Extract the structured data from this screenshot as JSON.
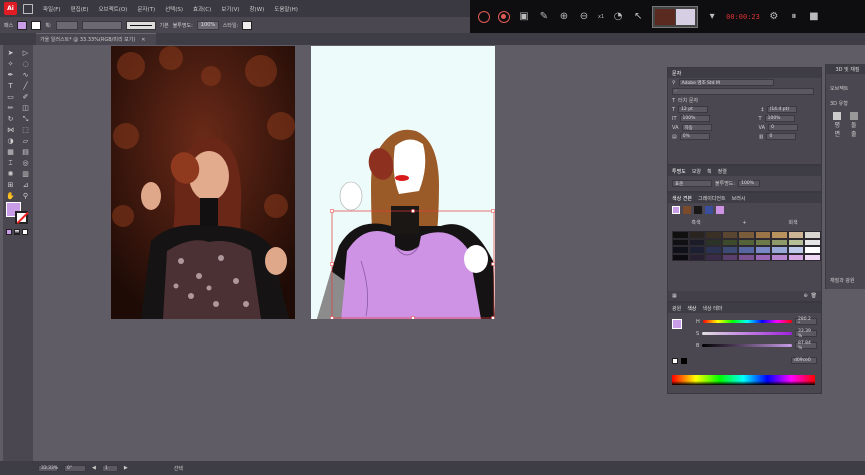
{
  "menubar": {
    "logo": "Ai",
    "items": [
      "파일(F)",
      "편집(E)",
      "오브젝트(O)",
      "문자(T)",
      "선택(S)",
      "효과(C)",
      "보기(V)",
      "창(W)",
      "도움말(H)"
    ]
  },
  "controlbar": {
    "selection_label": "패스",
    "stroke_label": "획:",
    "brush_label": "기본",
    "opacity_label": "불투명도:",
    "opacity_value": "100%",
    "style_label": "스타일:"
  },
  "doc_tab": {
    "title": "가을 일러스트* @ 33.33%(RGB/미리 보기)"
  },
  "colors": {
    "fill": "#c99ce8",
    "accent": "#e05a55"
  },
  "character_panel": {
    "tab_label": "문자",
    "font_family": "Adobe 명조 Std M",
    "font_style": "-",
    "touch_type_label": "터치 문자",
    "font_size": "12 pt",
    "leading": "(14.4 pt)",
    "vscale": "100%",
    "hscale": "100%",
    "kerning": "자동",
    "tracking": "0",
    "tsume": "0%",
    "aki": "0"
  },
  "appearance_panel": {
    "tabs": [
      "투명도",
      "모양",
      "획",
      "정렬"
    ],
    "blend_mode": "표준",
    "opacity_label": "불투명도:",
    "opacity_value": "100%"
  },
  "swatches_panel": {
    "tabs": [
      "색상 견본",
      "그레이디언트",
      "브러시"
    ],
    "group1_label": "흑색",
    "group2_label": "+",
    "group3_label": "회색",
    "swatch_colors": [
      "#101010",
      "#2a2420",
      "#3b3026",
      "#5a4530",
      "#7a5c3a",
      "#9b7448",
      "#b8935e",
      "#cdb495",
      "#d9d6d2",
      "#0f0f14",
      "#1c1c28",
      "#2b3326",
      "#3e4a2c",
      "#55633a",
      "#6d7a4a",
      "#8f9a6a",
      "#b6bf98",
      "#e6e6e6",
      "#101018",
      "#1d2033",
      "#2c3352",
      "#3d4a73",
      "#5566a0",
      "#7a88c8",
      "#9aa8d8",
      "#bfc9ea",
      "#ffffff",
      "#0c0c10",
      "#262030",
      "#3a2c48",
      "#5a3f6c",
      "#7b5292",
      "#9a66b6",
      "#b986d0",
      "#d5a8e4",
      "#efd8f4"
    ]
  },
  "color_panel": {
    "tabs": [
      "색상",
      "색상 테마"
    ],
    "h_label": "H",
    "h_value": "280.2 °",
    "s_label": "S",
    "s_value": "33.39 %",
    "b_label": "B",
    "b_value": "87.84 %",
    "hex_value": "d09ce0",
    "guide_tab": "광원"
  },
  "side_panel": {
    "tabs": [
      "3D 및 재질",
      "오브젝트"
    ],
    "sections": [
      "3D 유형",
      "평면",
      "돌출",
      "회전",
      "부풀리기"
    ],
    "footer": "재질과 광원"
  },
  "recorder": {
    "timer": "00:00:23",
    "zoom": "x1"
  },
  "statusbar": {
    "zoom": "33.33%",
    "rotation": "0°",
    "artboard": "1",
    "tool": "선택"
  }
}
